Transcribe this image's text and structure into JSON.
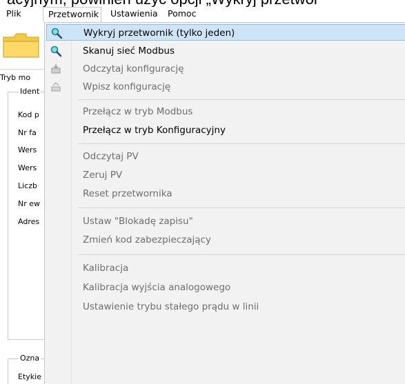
{
  "top_text": "acyjnym, powinien użyć opcji „Wykryj przetwor",
  "menubar": {
    "items": [
      "Plik",
      "Przetwornik",
      "Ustawienia",
      "Pomoc"
    ]
  },
  "left_panel": {
    "mode_label": "Tryb mo",
    "group1_title": "Ident",
    "fields": [
      "Kod p",
      "Nr fa",
      "Wers",
      "Wers",
      "Liczb",
      "Nr ew",
      "Adres"
    ],
    "group2_title": "Ozna",
    "group2_fields": [
      "Etykie"
    ]
  },
  "dropdown": {
    "items": [
      {
        "label": "Wykryj przetwornik (tylko jeden)",
        "enabled": true,
        "highlighted": true,
        "icon": "magnifier-icon"
      },
      {
        "label": "Skanuj sieć Modbus",
        "enabled": true,
        "highlighted": false,
        "icon": "magnifier-icon"
      },
      {
        "label": "Odczytaj konfigurację",
        "enabled": false,
        "highlighted": false,
        "icon": "read-config-icon"
      },
      {
        "label": "Wpisz konfigurację",
        "enabled": false,
        "highlighted": false,
        "icon": "write-config-icon"
      },
      {
        "label": "Przełącz w tryb Modbus",
        "enabled": false,
        "highlighted": false
      },
      {
        "label": "Przełącz w tryb Konfiguracyjny",
        "enabled": true,
        "highlighted": false
      },
      {
        "label": "Odczytaj PV",
        "enabled": false,
        "highlighted": false
      },
      {
        "label": "Zeruj PV",
        "enabled": false,
        "highlighted": false
      },
      {
        "label": "Reset przetwornika",
        "enabled": false,
        "highlighted": false
      },
      {
        "label": "Ustaw \"Blokadę zapisu\"",
        "enabled": false,
        "highlighted": false
      },
      {
        "label": "Zmień kod zabezpieczający",
        "enabled": false,
        "highlighted": false
      },
      {
        "label": "Kalibracja",
        "enabled": false,
        "highlighted": false
      },
      {
        "label": "Kalibracja wyjścia analogowego",
        "enabled": false,
        "highlighted": false
      },
      {
        "label": "Ustawienie trybu stałego prądu w linii",
        "enabled": false,
        "highlighted": false
      }
    ]
  },
  "colors": {
    "highlight_bg": "#cde4f7",
    "highlight_border": "#8cbfe9",
    "disabled_text": "#6d6d6d",
    "menu_bg": "#f2f2f2"
  }
}
